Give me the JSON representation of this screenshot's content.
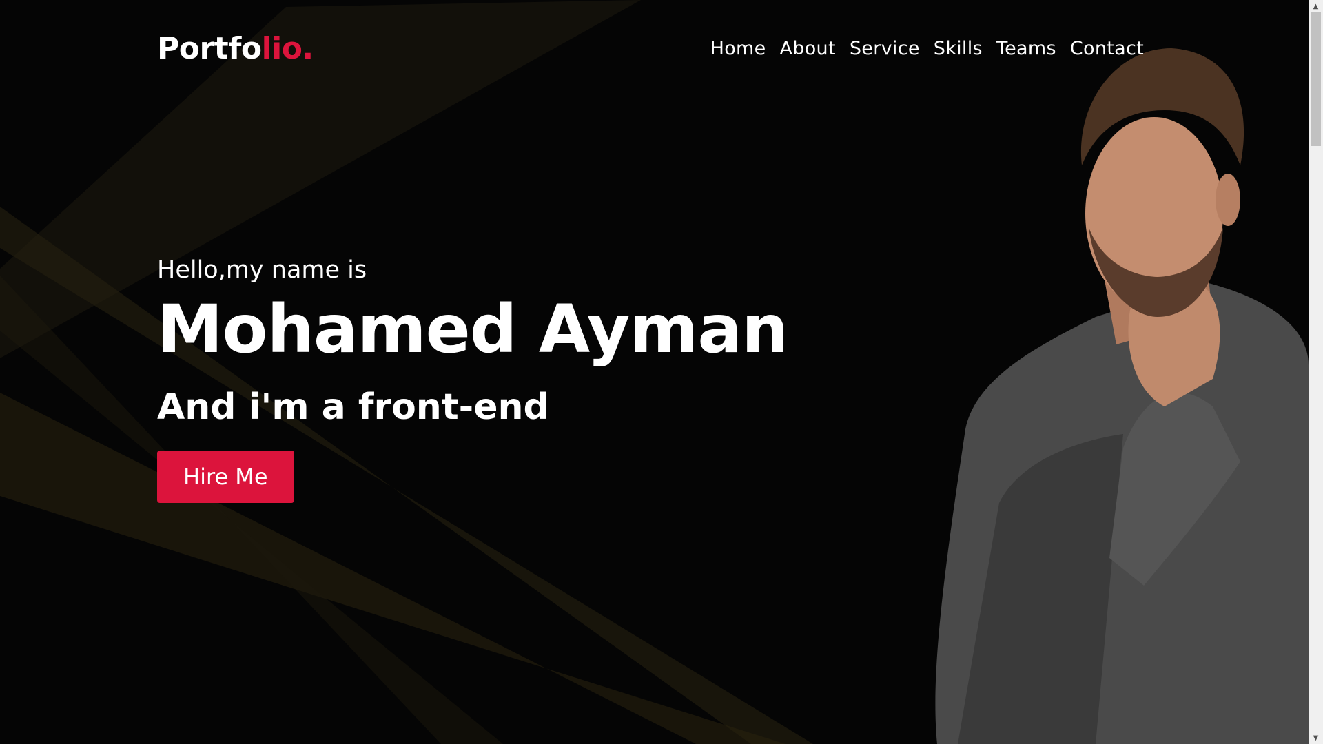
{
  "brand": {
    "logo_main": "Portfo",
    "logo_accent": "lio."
  },
  "nav": {
    "items": [
      "Home",
      "About",
      "Service",
      "Skills",
      "Teams",
      "Contact"
    ]
  },
  "hero": {
    "greeting": "Hello,my name is",
    "name": "Mohamed Ayman",
    "role": "And i'm a front-end",
    "cta_label": "Hire Me"
  },
  "colors": {
    "accent": "#dc143c",
    "background": "#050505",
    "text": "#ffffff"
  }
}
